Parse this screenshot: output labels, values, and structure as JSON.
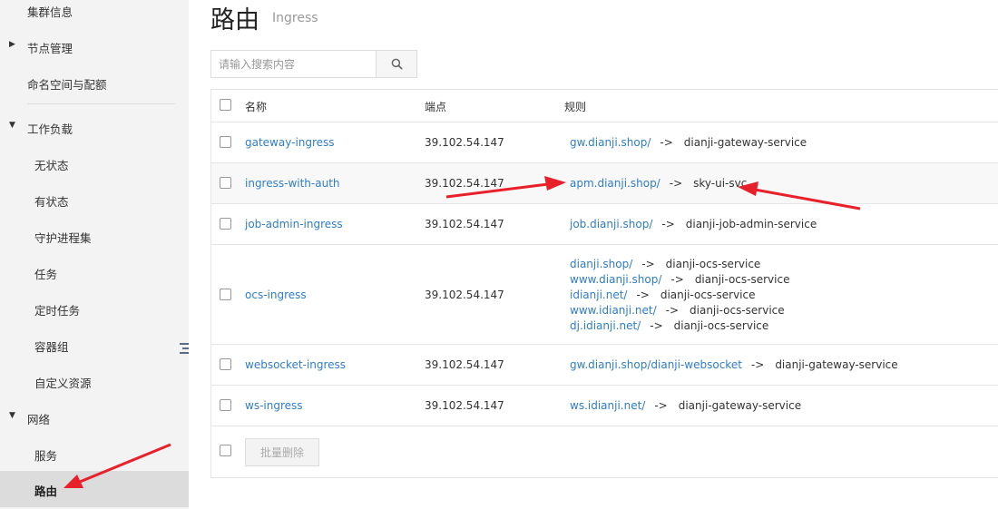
{
  "sidebar": {
    "items": [
      {
        "label": "集群信息"
      },
      {
        "label": "节点管理"
      },
      {
        "label": "命名空间与配额"
      },
      {
        "label": "工作负载"
      },
      {
        "label": "无状态"
      },
      {
        "label": "有状态"
      },
      {
        "label": "守护进程集"
      },
      {
        "label": "任务"
      },
      {
        "label": "定时任务"
      },
      {
        "label": "容器组"
      },
      {
        "label": "自定义资源"
      },
      {
        "label": "网络"
      },
      {
        "label": "服务"
      },
      {
        "label": "路由"
      }
    ]
  },
  "header": {
    "title": "路由",
    "subtitle": "Ingress"
  },
  "search": {
    "placeholder": "请输入搜索内容",
    "value": ""
  },
  "table": {
    "columns": [
      "名称",
      "端点",
      "规则"
    ],
    "rows": [
      {
        "name": "gateway-ingress",
        "endpoint": "39.102.54.147",
        "rules": [
          {
            "host": "gw.dianji.shop/",
            "arrow": "->",
            "service": "dianji-gateway-service"
          }
        ]
      },
      {
        "name": "ingress-with-auth",
        "endpoint": "39.102.54.147",
        "rules": [
          {
            "host": "apm.dianji.shop/",
            "arrow": "->",
            "service": "sky-ui-svc"
          }
        ]
      },
      {
        "name": "job-admin-ingress",
        "endpoint": "39.102.54.147",
        "rules": [
          {
            "host": "job.dianji.shop/",
            "arrow": "->",
            "service": "dianji-job-admin-service"
          }
        ]
      },
      {
        "name": "ocs-ingress",
        "endpoint": "39.102.54.147",
        "rules": [
          {
            "host": "dianji.shop/",
            "arrow": "->",
            "service": "dianji-ocs-service"
          },
          {
            "host": "www.dianji.shop/",
            "arrow": "->",
            "service": "dianji-ocs-service"
          },
          {
            "host": "idianji.net/",
            "arrow": "->",
            "service": "dianji-ocs-service"
          },
          {
            "host": "www.idianji.net/",
            "arrow": "->",
            "service": "dianji-ocs-service"
          },
          {
            "host": "dj.idianji.net/",
            "arrow": "->",
            "service": "dianji-ocs-service"
          }
        ]
      },
      {
        "name": "websocket-ingress",
        "endpoint": "39.102.54.147",
        "rules": [
          {
            "host": "gw.dianji.shop/dianji-websocket",
            "arrow": "->",
            "service": "dianji-gateway-service"
          }
        ]
      },
      {
        "name": "ws-ingress",
        "endpoint": "39.102.54.147",
        "rules": [
          {
            "host": "ws.idianji.net/",
            "arrow": "->",
            "service": "dianji-gateway-service"
          }
        ]
      }
    ],
    "batch_delete_label": "批量删除"
  },
  "colors": {
    "link": "#2f7dc6",
    "annotation": "#e8202a",
    "sidebar_bg": "#f3f3f3",
    "active_bg": "#dcdcdc"
  }
}
